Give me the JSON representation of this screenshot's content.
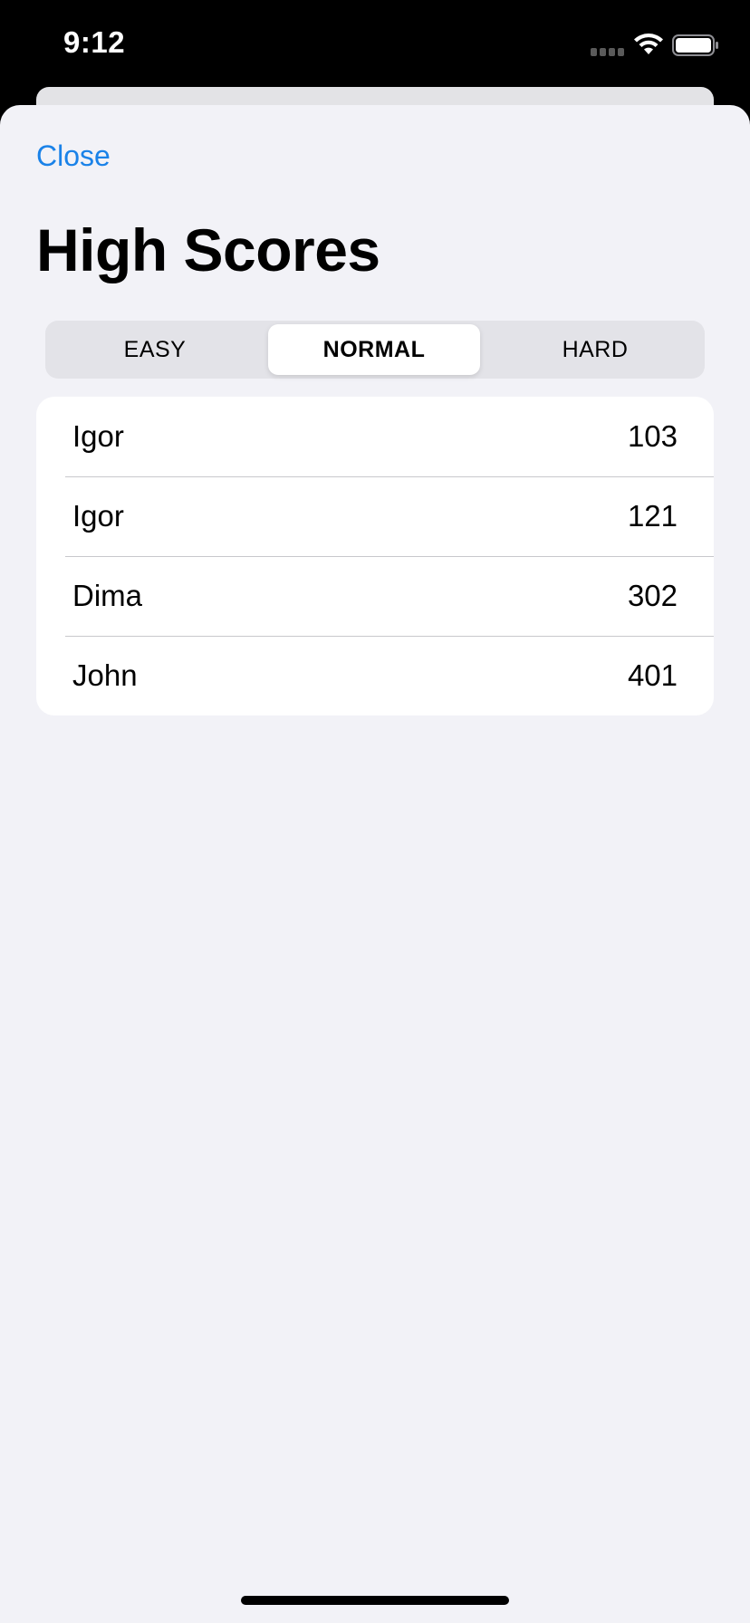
{
  "status_bar": {
    "time": "9:12",
    "icons": [
      "signal-icon",
      "wifi-icon",
      "battery-icon"
    ]
  },
  "sheet": {
    "close_label": "Close",
    "title": "High Scores"
  },
  "difficulty": {
    "options": [
      "EASY",
      "NORMAL",
      "HARD"
    ],
    "selected": "NORMAL"
  },
  "scores": [
    {
      "name": "Igor",
      "score": "103"
    },
    {
      "name": "Igor",
      "score": "121"
    },
    {
      "name": "Dima",
      "score": "302"
    },
    {
      "name": "John",
      "score": "401"
    }
  ],
  "colors": {
    "accent": "#1a82e8",
    "sheet_background": "#f2f2f7",
    "list_background": "#ffffff",
    "segmented_background": "#e3e3e8"
  }
}
